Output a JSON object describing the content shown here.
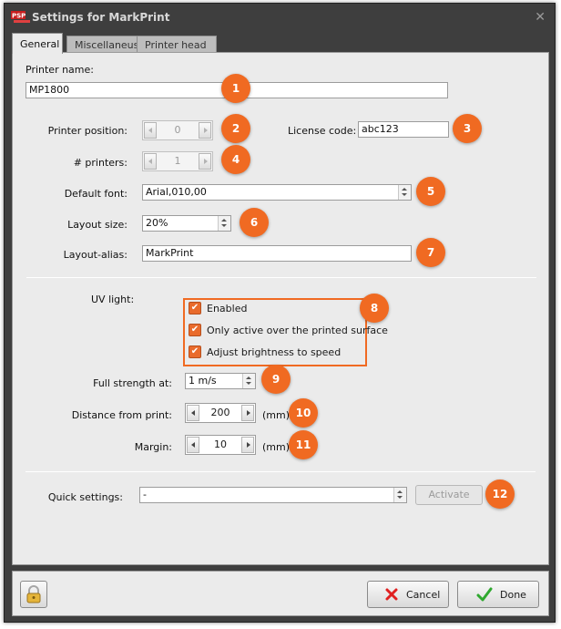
{
  "window": {
    "title": "Settings for MarkPrint"
  },
  "tabs": [
    {
      "label": "General",
      "active": true
    },
    {
      "label": "Miscellaneus",
      "active": false
    },
    {
      "label": "Printer head",
      "active": false
    }
  ],
  "general": {
    "printer_name": {
      "label": "Printer name:",
      "value": "MP1800"
    },
    "printer_position": {
      "label": "Printer position:",
      "value": "0",
      "disabled": true
    },
    "license_code": {
      "label": "License code:",
      "value": "abc123"
    },
    "num_printers": {
      "label": "# printers:",
      "value": "1",
      "disabled": true
    },
    "default_font": {
      "label": "Default font:",
      "value": "Arial,010,00"
    },
    "layout_size": {
      "label": "Layout size:",
      "value": "20%"
    },
    "layout_alias": {
      "label": "Layout-alias:",
      "value": "MarkPrint"
    },
    "uv_light": {
      "label": "UV light:",
      "options": [
        {
          "label": "Enabled",
          "checked": true
        },
        {
          "label": "Only active over the printed surface",
          "checked": true
        },
        {
          "label": "Adjust brightness to speed",
          "checked": true
        }
      ]
    },
    "full_strength": {
      "label": "Full strength at:",
      "value": "1 m/s"
    },
    "distance_from_print": {
      "label": "Distance from print:",
      "value": "200",
      "unit": "(mm)"
    },
    "margin": {
      "label": "Margin:",
      "value": "10",
      "unit": "(mm)"
    },
    "quick_settings": {
      "label": "Quick settings:",
      "value": "-",
      "activate_label": "Activate"
    }
  },
  "annotations": [
    "1",
    "2",
    "3",
    "4",
    "5",
    "6",
    "7",
    "8",
    "9",
    "10",
    "11",
    "12"
  ],
  "footer": {
    "cancel_label": "Cancel",
    "done_label": "Done"
  },
  "colors": {
    "accent": "#f06a22",
    "titlebar": "#3e3e3e",
    "panel": "#ebebeb",
    "check": "#e96b2c"
  },
  "icons": {
    "lock": "lock-icon",
    "cancel": "red-x-icon",
    "done": "green-check-icon",
    "close": "close-icon"
  }
}
